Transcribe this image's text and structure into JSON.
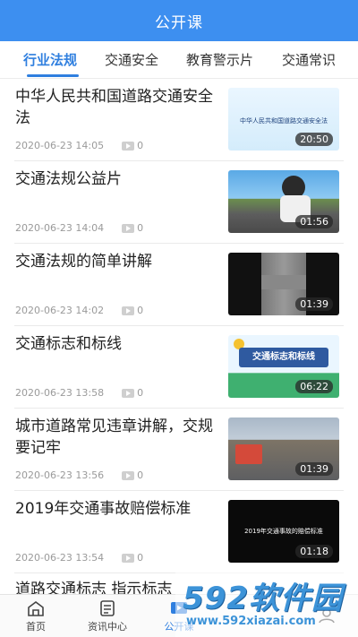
{
  "header": {
    "title": "公开课"
  },
  "tabs": [
    {
      "label": "行业法规",
      "active": true
    },
    {
      "label": "交通安全",
      "active": false
    },
    {
      "label": "教育警示片",
      "active": false
    },
    {
      "label": "交通常识",
      "active": false
    }
  ],
  "items": [
    {
      "title": "中华人民共和国道路交通安全法",
      "date": "2020-06-23 14:05",
      "plays": "0",
      "duration": "20:50",
      "thumb_caption": "中华人民共和国道路交通安全法"
    },
    {
      "title": "交通法规公益片",
      "date": "2020-06-23 14:04",
      "plays": "0",
      "duration": "01:56"
    },
    {
      "title": "交通法规的简单讲解",
      "date": "2020-06-23 14:02",
      "plays": "0",
      "duration": "01:39"
    },
    {
      "title": "交通标志和标线",
      "date": "2020-06-23 13:58",
      "plays": "0",
      "duration": "06:22",
      "thumb_caption": "交通标志和标线"
    },
    {
      "title": "城市道路常见违章讲解，交规要记牢",
      "date": "2020-06-23 13:56",
      "plays": "0",
      "duration": "01:39"
    },
    {
      "title": "2019年交通事故赔偿标准",
      "date": "2020-06-23 13:54",
      "plays": "0",
      "duration": "01:18",
      "thumb_caption": "2019年交通事故的赔偿标准"
    }
  ],
  "partial_item_title": "道路交通标志 指示标志",
  "bottom_nav": [
    {
      "label": "首页",
      "icon": "home-icon"
    },
    {
      "label": "资讯中心",
      "icon": "news-icon"
    },
    {
      "label": "公开课",
      "icon": "course-icon",
      "active": true
    },
    {
      "label": "",
      "icon": "user-icon"
    }
  ],
  "watermark": {
    "logo": "592软件园",
    "url": "www.592xiazai.com"
  },
  "colors": {
    "primary": "#3d8ff0",
    "active_tab": "#2f7fdf",
    "meta_gray": "#9a9a9a"
  }
}
